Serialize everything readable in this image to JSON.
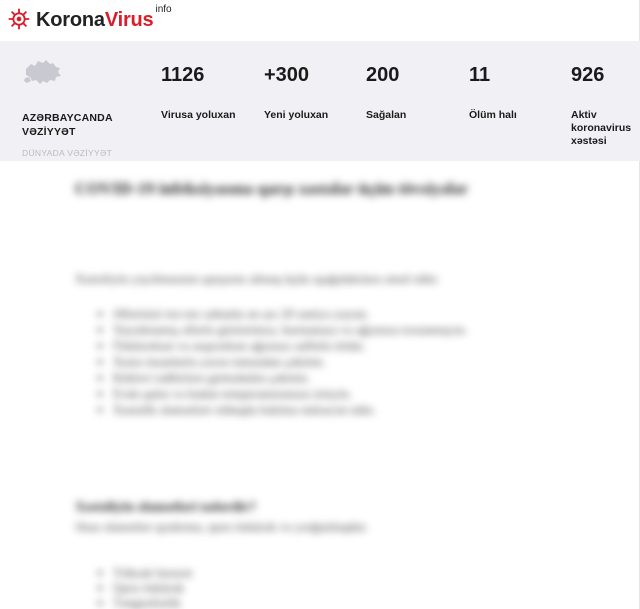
{
  "header": {
    "logo_part1": "Korona",
    "logo_part2": "Virus",
    "logo_sup": "info",
    "logo_icon": "virus-icon",
    "brand_color": "#d81e2b"
  },
  "stats_panel": {
    "region_title": "AZƏRBAYCANDA VƏZİYYƏT",
    "world_link": "DÜNYADA VƏZİYYƏT",
    "map_icon": "azerbaijan-map-icon",
    "stats": [
      {
        "value": "1126",
        "label": "Virusa yoluxan"
      },
      {
        "value": "+300",
        "label": "Yeni yoluxan"
      },
      {
        "value": "200",
        "label": "Sağalan"
      },
      {
        "value": "11",
        "label": "Ölüm halı"
      },
      {
        "value": "926",
        "label": "Aktiv koronavirus xəstəsi"
      }
    ]
  },
  "article": {
    "title": "COVID-19 infeksiyasına qarşı xəstələr üçün tövsiyələr",
    "intro": "Xəstəliyin yayılmasının qarşısını almaq üçün aşağıdakılara əməl edin:",
    "bullets": [
      "Əllərinizi tez-tez sabunla ən azı 20 saniyə yuyun.",
      "Yuyulmamış əllərlə gözlərinizə, burnunuza və ağzınıza toxunmayın.",
      "Öskürərkən və asqırarkən ağzınızı salfetlə örtün.",
      "Xəstə insanlarla yaxın təmasdan çəkinin.",
      "Kütləvi tədbirlərə getməkdən çəkinin.",
      "Evdə qalın və bədən temperaturunuzu izləyin.",
      "Xəstəlik əlamətləri olduqda həkimə müraciət edin."
    ],
    "subhead": "Xəstəliyin əlamətləri nələrdir?",
    "para2": "Əsas əlamətlər qızdırma, quru öskürək və yorğunluqdur.",
    "bullets2": [
      "Yüksək hərarət",
      "Quru öskürək",
      "Təngnəfəslik"
    ]
  }
}
